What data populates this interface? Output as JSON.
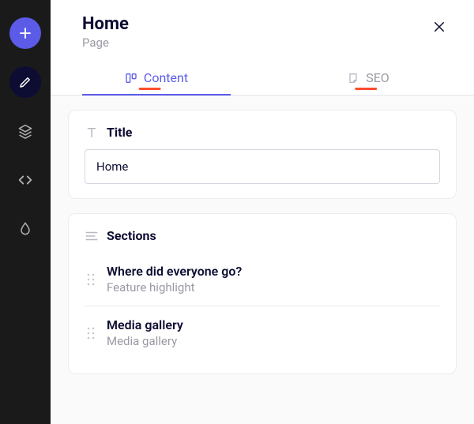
{
  "header": {
    "title": "Home",
    "type": "Page"
  },
  "tabs": {
    "content": "Content",
    "seo": "SEO"
  },
  "fields": {
    "title_label": "Title",
    "title_value": "Home",
    "sections_label": "Sections"
  },
  "sections": [
    {
      "title": "Where did everyone go?",
      "subtitle": "Feature highlight"
    },
    {
      "title": "Media gallery",
      "subtitle": "Media gallery"
    }
  ]
}
